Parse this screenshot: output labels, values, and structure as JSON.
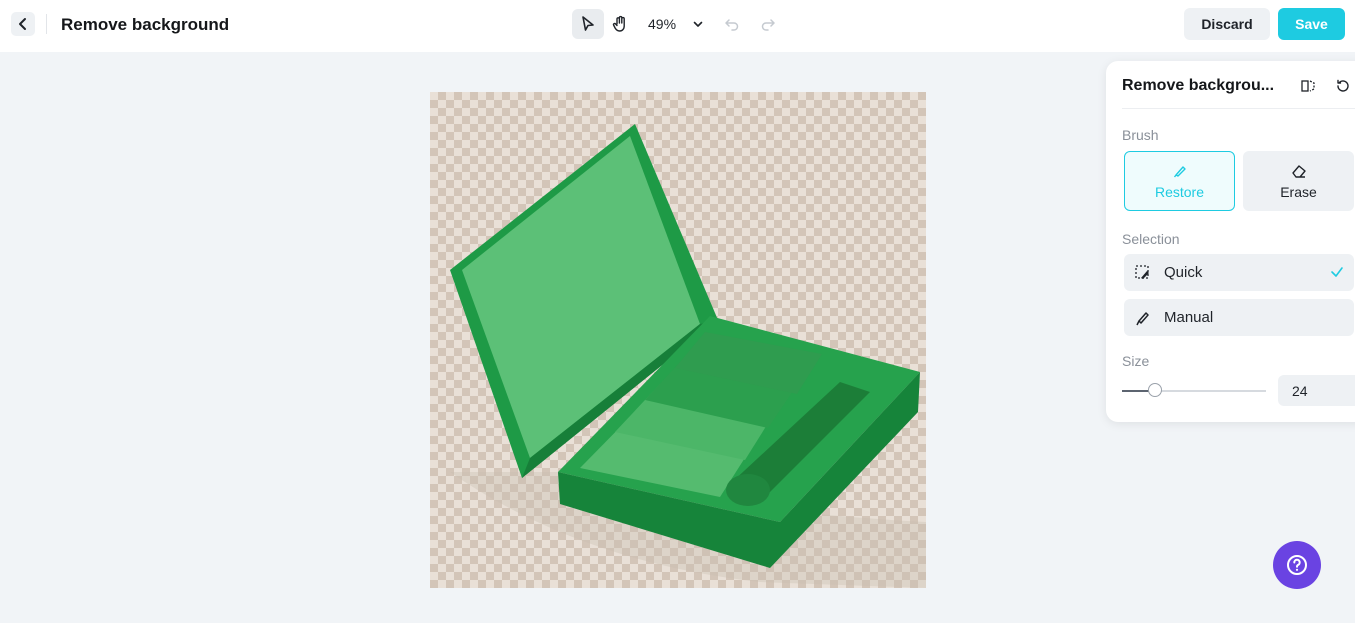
{
  "header": {
    "title": "Remove background",
    "zoom": "49%",
    "discard_label": "Discard",
    "save_label": "Save",
    "tools": [
      "select-arrow-icon",
      "hand-icon",
      "chevron-down-icon",
      "undo-icon",
      "redo-icon"
    ]
  },
  "panel": {
    "title": "Remove backgrou...",
    "brush_label": "Brush",
    "brush_options": [
      {
        "label": "Restore",
        "icon": "brush-icon",
        "selected": true
      },
      {
        "label": "Erase",
        "icon": "eraser-icon",
        "selected": false
      }
    ],
    "selection_label": "Selection",
    "selection_options": [
      {
        "label": "Quick",
        "icon": "quick-select-icon",
        "selected": true
      },
      {
        "label": "Manual",
        "icon": "brush-icon",
        "selected": false
      }
    ],
    "size_label": "Size",
    "size_value": "24",
    "size_slider_fraction": 0.23
  },
  "colors": {
    "accent": "#1ecbe1",
    "help_button": "#6a43e2",
    "mask_green": "#22a34a"
  },
  "help_icon": "question-mark-icon"
}
